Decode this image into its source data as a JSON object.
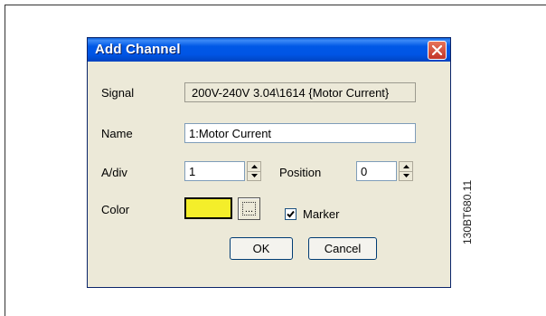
{
  "dialog": {
    "title": "Add Channel",
    "close_icon": "close-icon",
    "signal": {
      "label": "Signal",
      "value": "200V-240V 3.04\\1614 {Motor Current}"
    },
    "name": {
      "label": "Name",
      "value": "1:Motor Current"
    },
    "a_div": {
      "label": "A/div",
      "value": "1"
    },
    "position": {
      "label": "Position",
      "value": "0"
    },
    "color": {
      "label": "Color",
      "swatch": "#f4ee2a",
      "picker_glyph": "..."
    },
    "marker": {
      "label": "Marker",
      "checked": true
    },
    "buttons": {
      "ok": "OK",
      "cancel": "Cancel"
    }
  },
  "figure_code": "130BT680.11"
}
